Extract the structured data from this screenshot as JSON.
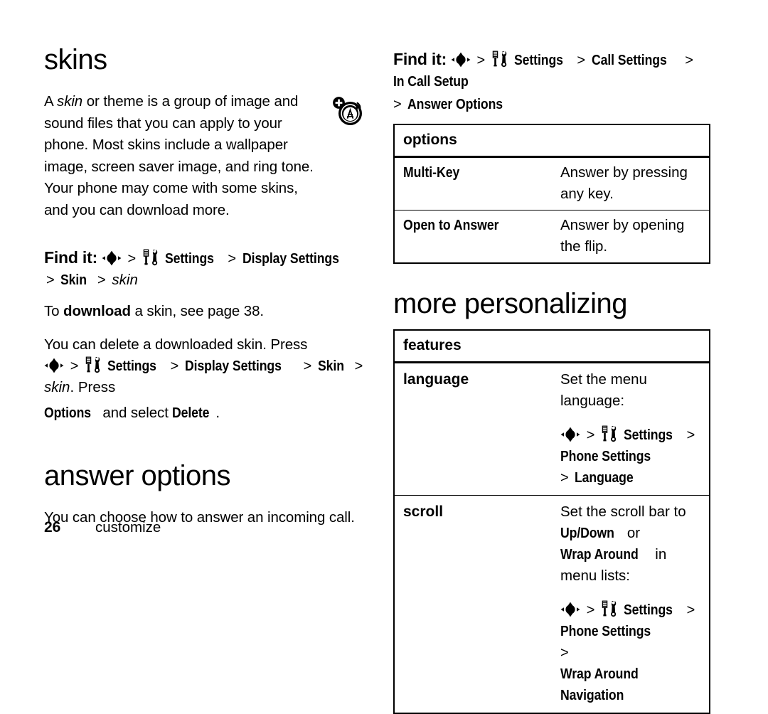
{
  "page": {
    "number": "26",
    "chapter": "customize"
  },
  "left": {
    "skins": {
      "title": "skins",
      "intro_before_italic": "A ",
      "intro_italic": "skin",
      "intro_after": " or theme is a group of image and sound files that you can apply to your phone. Most skins include a wallpaper image, screen saver image, and ring tone. Your phone may come with some skins, and you can download more.",
      "badge_icon": "radio-tower-plus-icon",
      "find_it": {
        "label": "Find it:",
        "nav_icon": "navigation-key-icon",
        "sep": ">",
        "settings_icon": "settings-tools-icon",
        "steps": [
          "Settings",
          "Display Settings",
          "Skin"
        ],
        "final_italic": "skin"
      },
      "download_note_pre": "To ",
      "download_note_bold": "download",
      "download_note_post": " a skin, see page 38.",
      "delete_note_line1": "You can delete a downloaded skin. Press",
      "delete_path_steps": [
        "Settings",
        "Display Settings",
        "Skin"
      ],
      "delete_path_italic": "skin",
      "delete_note_mid": ". Press",
      "delete_options": "Options",
      "delete_and_select": " and select ",
      "delete_word": "Delete",
      "delete_period": "."
    },
    "answer_options": {
      "title": "answer options",
      "intro": "You can choose how to answer an incoming call."
    }
  },
  "right": {
    "find_it": {
      "label": "Find it:",
      "nav_icon": "navigation-key-icon",
      "sep": ">",
      "settings_icon": "settings-tools-icon",
      "steps": [
        "Settings",
        "Call Settings",
        "In Call Setup"
      ],
      "wrap_step": "Answer Options"
    },
    "options_table": {
      "header": "options",
      "rows": [
        {
          "key": "Multi-Key",
          "value": "Answer by pressing any key."
        },
        {
          "key": "Open to Answer",
          "value": "Answer by opening the flip."
        }
      ]
    },
    "more_personalizing": {
      "title": "more personalizing",
      "table": {
        "header": "features",
        "rows": [
          {
            "key": "language",
            "value_line1": "Set the menu language:",
            "path_steps": [
              "Settings",
              "Phone Settings"
            ],
            "path_wrap": "Language"
          },
          {
            "key": "scroll",
            "value_pre": "Set the scroll bar to ",
            "value_menu1": "Up/Down",
            "value_mid": " or ",
            "value_menu2": "Wrap Around",
            "value_post": " in menu lists:",
            "path_steps": [
              "Settings",
              "Phone Settings"
            ],
            "path_wrap": "Wrap Around Navigation"
          }
        ]
      }
    }
  },
  "icons": {
    "navigation_key": "navigation-key-icon",
    "settings_tools": "settings-tools-icon",
    "radio_tower_plus": "radio-tower-plus-icon"
  }
}
